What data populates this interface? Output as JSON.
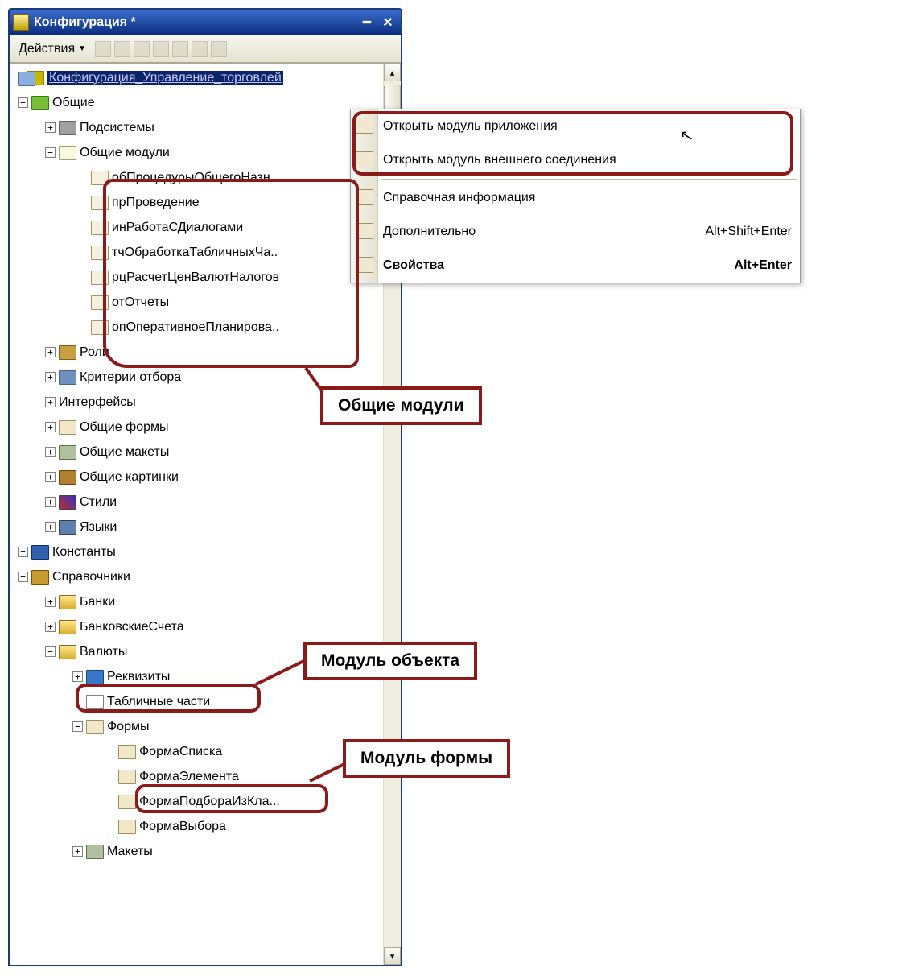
{
  "window": {
    "title": "Конфигурация *"
  },
  "toolbar": {
    "actions_label": "Действия"
  },
  "tree": {
    "root": "Конфигурация_Управление_торговлей",
    "common": "Общие",
    "common_children": {
      "subsystems": "Подсистемы",
      "common_modules": "Общие модули",
      "modules": [
        "обПроцедурыОбщегоНазн..",
        "прПроведение",
        "инРаботаСДиалогами",
        "тчОбработкаТабличныхЧа..",
        "рцРасчетЦенВалютНалогов",
        "отОтчеты",
        "опОперативноеПланирова.."
      ],
      "roles": "Роли",
      "filters": "Критерии отбора",
      "interfaces": "Интерфейсы",
      "common_forms": "Общие формы",
      "common_layouts": "Общие макеты",
      "common_pictures": "Общие картинки",
      "styles": "Стили",
      "languages": "Языки"
    },
    "constants": "Константы",
    "catalogs": "Справочники",
    "catalogs_children": {
      "banks": "Банки",
      "bank_accounts": "БанковскиеСчета",
      "currencies": "Валюты",
      "currencies_children": {
        "attributes": "Реквизиты",
        "tabular": "Табличные части",
        "forms": "Формы",
        "forms_list": [
          "ФормаСписка",
          "ФормаЭлемента",
          "ФормаПодбораИзКла...",
          "ФормаВыбора"
        ],
        "layouts": "Макеты"
      }
    }
  },
  "context_menu": {
    "open_app_module": "Открыть модуль приложения",
    "open_ext_module": "Открыть модуль внешнего соединения",
    "help": "Справочная информация",
    "additional": "Дополнительно",
    "additional_shortcut": "Alt+Shift+Enter",
    "properties": "Свойства",
    "properties_shortcut": "Alt+Enter"
  },
  "callouts": {
    "common_modules": "Общие модули",
    "object_module": "Модуль объекта",
    "form_module": "Модуль формы"
  }
}
